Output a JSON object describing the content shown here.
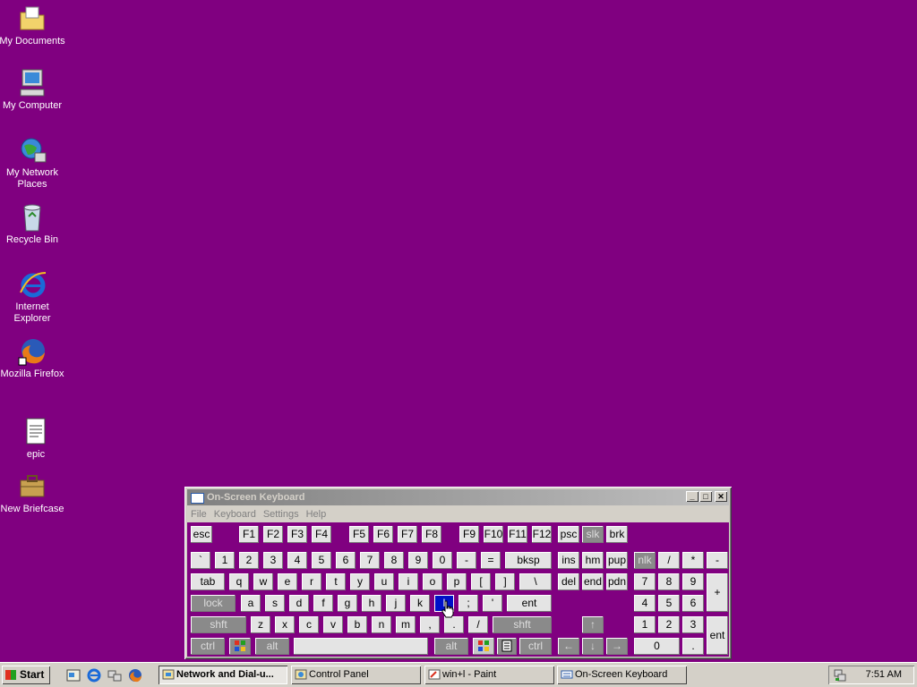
{
  "desktop": {
    "background": "#800080",
    "icons": [
      {
        "label": "My Documents",
        "icon": "folder-icon"
      },
      {
        "label": "My Computer",
        "icon": "computer-icon"
      },
      {
        "label": "My Network Places",
        "icon": "network-icon"
      },
      {
        "label": "Recycle Bin",
        "icon": "recycle-bin-icon"
      },
      {
        "label": "Internet Explorer",
        "icon": "ie-icon"
      },
      {
        "label": "Mozilla Firefox",
        "icon": "firefox-icon"
      },
      {
        "label": "epic",
        "icon": "document-icon"
      },
      {
        "label": "New Briefcase",
        "icon": "briefcase-icon"
      }
    ]
  },
  "osk": {
    "title": "On-Screen Keyboard",
    "menu": [
      "File",
      "Keyboard",
      "Settings",
      "Help"
    ],
    "selected_key": "l",
    "keys": {
      "esc": "esc",
      "f": [
        "F1",
        "F2",
        "F3",
        "F4",
        "F5",
        "F6",
        "F7",
        "F8",
        "F9",
        "F10",
        "F11",
        "F12"
      ],
      "psc": "psc",
      "slk": "slk",
      "brk": "brk",
      "row1": [
        "`",
        "1",
        "2",
        "3",
        "4",
        "5",
        "6",
        "7",
        "8",
        "9",
        "0",
        "-",
        "="
      ],
      "bksp": "bksp",
      "ins": "ins",
      "hm": "hm",
      "pup": "pup",
      "nlk": "nlk",
      "div": "/",
      "mul": "*",
      "sub": "-",
      "tab": "tab",
      "row2": [
        "q",
        "w",
        "e",
        "r",
        "t",
        "y",
        "u",
        "i",
        "o",
        "p",
        "[",
        "]",
        "\\"
      ],
      "del": "del",
      "end": "end",
      "pdn": "pdn",
      "n7": "7",
      "n8": "8",
      "n9": "9",
      "add": "+",
      "lock": "lock",
      "row3": [
        "a",
        "s",
        "d",
        "f",
        "g",
        "h",
        "j",
        "k",
        "l",
        ";",
        "'"
      ],
      "ent": "ent",
      "n4": "4",
      "n5": "5",
      "n6": "6",
      "shft": "shft",
      "row4": [
        "z",
        "x",
        "c",
        "v",
        "b",
        "n",
        "m",
        ",",
        ".",
        "/"
      ],
      "n1": "1",
      "n2": "2",
      "n3": "3",
      "nent": "ent",
      "ctrl": "ctrl",
      "alt": "alt",
      "n0": "0",
      "ndot": "."
    }
  },
  "taskbar": {
    "start": "Start",
    "buttons": [
      {
        "label": "Network and Dial-u...",
        "active": true
      },
      {
        "label": "Control Panel",
        "active": false
      },
      {
        "label": "win+l - Paint",
        "active": false
      },
      {
        "label": "On-Screen Keyboard",
        "active": false
      }
    ],
    "clock": "7:51 AM"
  }
}
